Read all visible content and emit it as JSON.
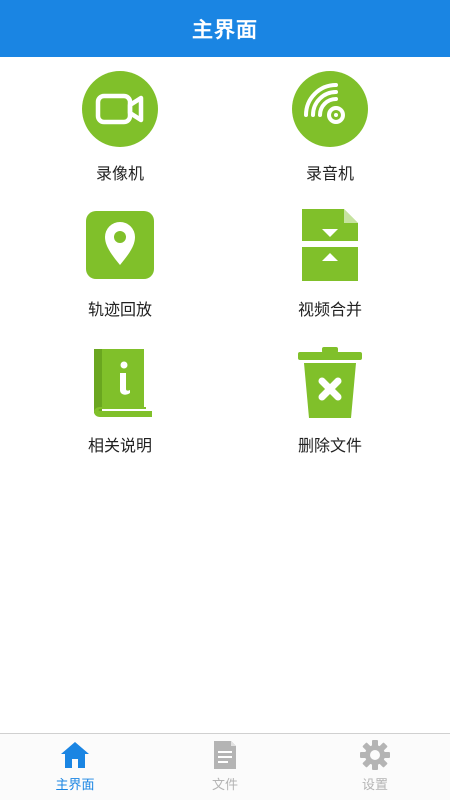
{
  "header": {
    "title": "主界面"
  },
  "colors": {
    "accent": "#1a85e3",
    "icon_green": "#80c02a",
    "tab_active": "#1a85e3",
    "tab_inactive": "#b4b4b4"
  },
  "menu": {
    "items": [
      {
        "label": "录像机",
        "icon": "video-camera-icon"
      },
      {
        "label": "录音机",
        "icon": "audio-disc-icon"
      },
      {
        "label": "轨迹回放",
        "icon": "location-pin-icon"
      },
      {
        "label": "视频合并",
        "icon": "file-merge-icon"
      },
      {
        "label": "相关说明",
        "icon": "info-book-icon"
      },
      {
        "label": "删除文件",
        "icon": "trash-icon"
      }
    ]
  },
  "tabs": {
    "items": [
      {
        "label": "主界面",
        "icon": "home-icon",
        "active": true
      },
      {
        "label": "文件",
        "icon": "document-icon",
        "active": false
      },
      {
        "label": "设置",
        "icon": "gear-icon",
        "active": false
      }
    ]
  }
}
